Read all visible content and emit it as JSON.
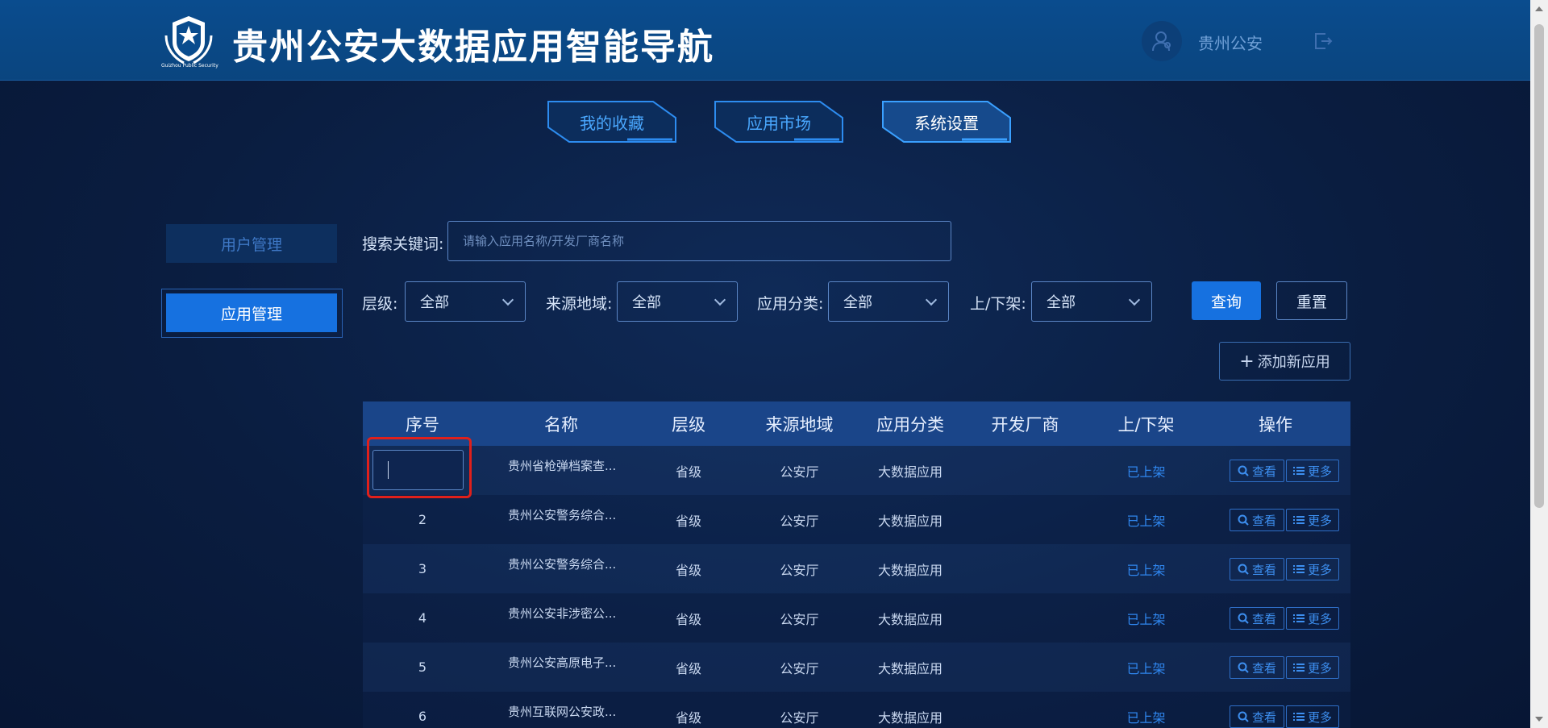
{
  "header": {
    "title": "贵州公安大数据应用智能导航",
    "logo_caption": "Guizhou Public Security",
    "user_name": "贵州公安"
  },
  "tabs": [
    {
      "label": "我的收藏",
      "active": false
    },
    {
      "label": "应用市场",
      "active": false
    },
    {
      "label": "系统设置",
      "active": true
    }
  ],
  "sidebar": {
    "items": [
      {
        "label": "用户管理",
        "active": false
      },
      {
        "label": "应用管理",
        "active": true
      }
    ]
  },
  "filters": {
    "search_label": "搜索关键词:",
    "search_placeholder": "请输入应用名称/开发厂商名称",
    "level_label": "层级:",
    "level_value": "全部",
    "region_label": "来源地域:",
    "region_value": "全部",
    "category_label": "应用分类:",
    "category_value": "全部",
    "shelf_label": "上/下架:",
    "shelf_value": "全部",
    "query_button": "查询",
    "reset_button": "重置",
    "add_button": "添加新应用"
  },
  "table": {
    "columns": [
      "序号",
      "名称",
      "层级",
      "来源地域",
      "应用分类",
      "开发厂商",
      "上/下架",
      "操作"
    ],
    "view_label": "查看",
    "more_label": "更多",
    "rows": [
      {
        "seq": "",
        "name": "贵州省枪弹档案查...",
        "level": "省级",
        "region": "公安厅",
        "category": "大数据应用",
        "vendor": "",
        "status": "已上架"
      },
      {
        "seq": "2",
        "name": "贵州公安警务综合...",
        "level": "省级",
        "region": "公安厅",
        "category": "大数据应用",
        "vendor": "",
        "status": "已上架"
      },
      {
        "seq": "3",
        "name": "贵州公安警务综合...",
        "level": "省级",
        "region": "公安厅",
        "category": "大数据应用",
        "vendor": "",
        "status": "已上架"
      },
      {
        "seq": "4",
        "name": "贵州公安非涉密公...",
        "level": "省级",
        "region": "公安厅",
        "category": "大数据应用",
        "vendor": "",
        "status": "已上架"
      },
      {
        "seq": "5",
        "name": "贵州公安高原电子...",
        "level": "省级",
        "region": "公安厅",
        "category": "大数据应用",
        "vendor": "",
        "status": "已上架"
      },
      {
        "seq": "6",
        "name": "贵州互联网公安政...",
        "level": "省级",
        "region": "公安厅",
        "category": "大数据应用",
        "vendor": "",
        "status": "已上架"
      }
    ]
  }
}
